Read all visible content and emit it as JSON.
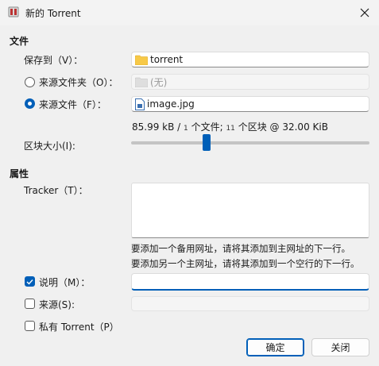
{
  "window": {
    "title": "新的 Torrent"
  },
  "files_section": {
    "heading": "文件"
  },
  "save_to": {
    "label": "保存到（V）：",
    "value": "torrent"
  },
  "source_folder": {
    "label": "来源文件夹（O）：",
    "value": "(无)",
    "selected": false
  },
  "source_file": {
    "label": "来源文件（F）：",
    "value": "image.jpg",
    "selected": true
  },
  "summary": {
    "size": "85.99 kB / ",
    "files_count": "1",
    "files_label": " 个文件;",
    "chunks_count": "11",
    "chunks_label": " 个区块 @ 32.00 KiB"
  },
  "chunk_size": {
    "label": "区块大小(I):",
    "position_fraction": 0.31
  },
  "properties_section": {
    "heading": "属性"
  },
  "tracker": {
    "label": "Tracker（T）：",
    "value": "",
    "hint_line1": "要添加一个备用网址，请将其添加到主网址的下一行。",
    "hint_line2": "要添加另一个主网址，请将其添加到一个空行的下一行。"
  },
  "description": {
    "label": "说明（M）：",
    "checked": true,
    "value": ""
  },
  "source": {
    "label": "来源(S):",
    "checked": false,
    "value": ""
  },
  "private": {
    "label": "私有 Torrent（P）",
    "checked": false
  },
  "buttons": {
    "ok": "确定",
    "cancel": "关闭"
  },
  "colors": {
    "accent": "#005fb8",
    "folder": "#f7c948"
  },
  "icons": {
    "app": "app-icon",
    "close": "close-icon",
    "folder": "folder-icon",
    "file": "image-file-icon"
  }
}
